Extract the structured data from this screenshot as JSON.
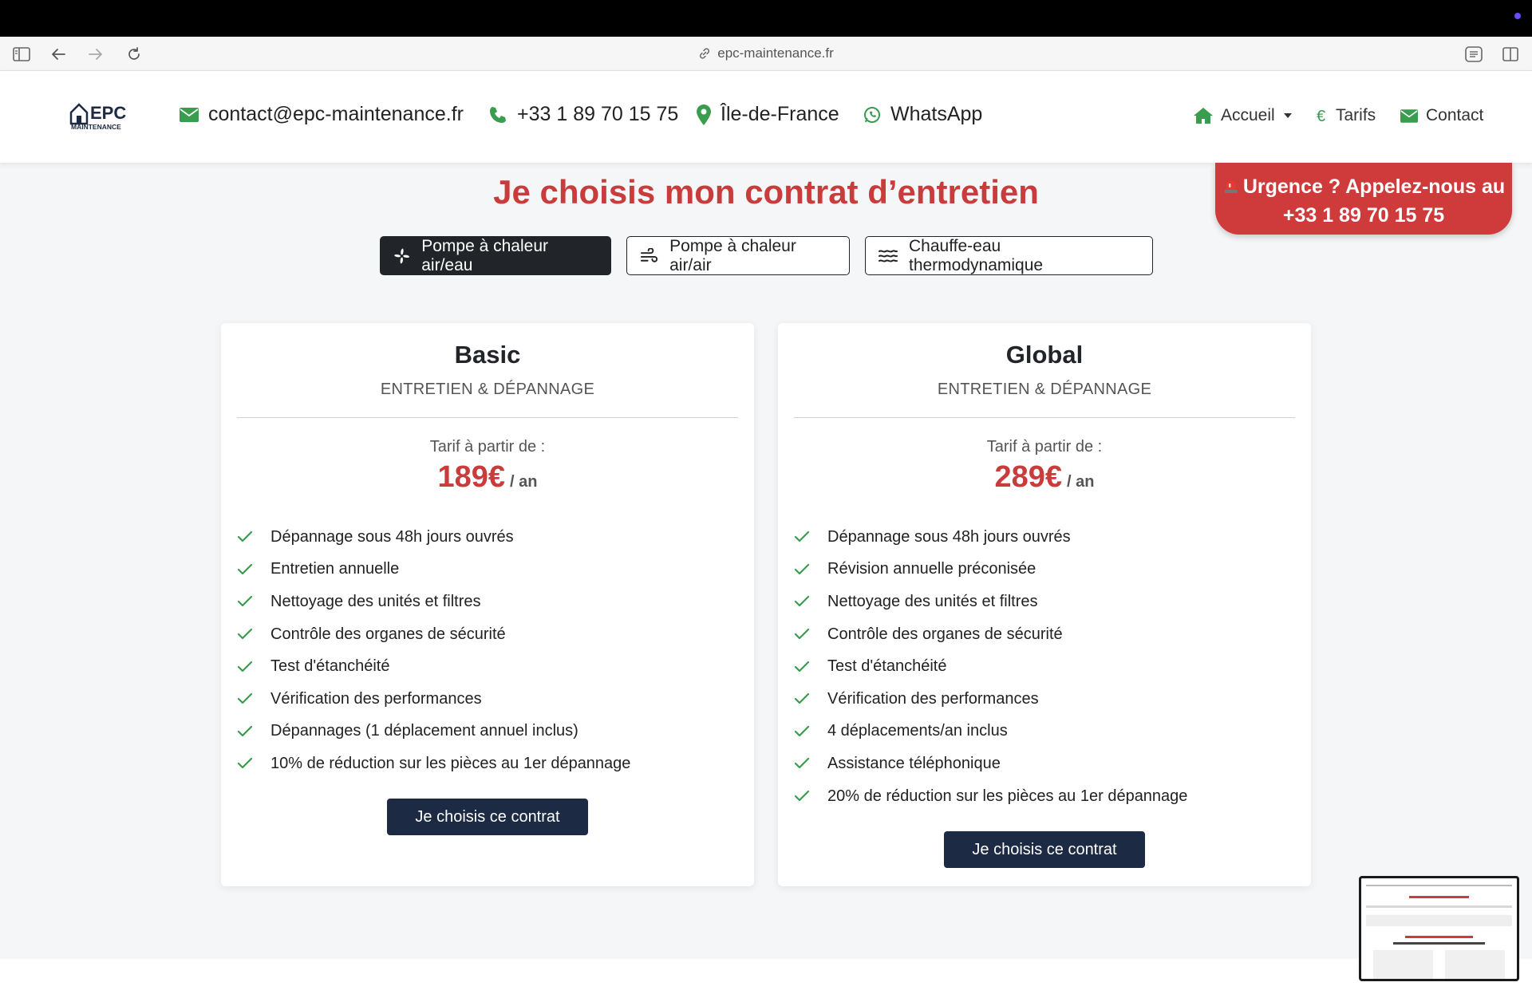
{
  "browser": {
    "url": "epc-maintenance.fr"
  },
  "header": {
    "logo_text": "EPC",
    "logo_subtext": "MAINTENANCE",
    "email": "contact@epc-maintenance.fr",
    "phone": "+33 1 89 70 15 75",
    "region": "Île-de-France",
    "whatsapp": "WhatsApp",
    "nav": {
      "home": "Accueil",
      "prices": "Tarifs",
      "contact": "Contact"
    }
  },
  "urgent": {
    "line1": "Urgence ? Appelez-nous au",
    "line2": "+33 1 89 70 15 75"
  },
  "main": {
    "title": "Je choisis mon contrat d’entretien",
    "tabs": [
      {
        "label": "Pompe à chaleur air/eau",
        "active": true
      },
      {
        "label": "Pompe à chaleur air/air",
        "active": false
      },
      {
        "label": "Chauffe-eau thermodynamique",
        "active": false
      }
    ]
  },
  "plans": [
    {
      "name": "Basic",
      "subtitle": "ENTRETIEN & DÉPANNAGE",
      "from_label": "Tarif à partir de :",
      "price": "189€",
      "period": "/ an",
      "features": [
        "Dépannage sous 48h jours ouvrés",
        "Entretien annuelle",
        "Nettoyage des unités et filtres",
        "Contrôle des organes de sécurité",
        "Test d'étanchéité",
        "Vérification des performances",
        "Dépannages (1 déplacement annuel inclus)",
        "10% de réduction sur les pièces au 1er dépannage"
      ],
      "cta": "Je choisis ce contrat"
    },
    {
      "name": "Global",
      "subtitle": "ENTRETIEN & DÉPANNAGE",
      "from_label": "Tarif à partir de :",
      "price": "289€",
      "period": "/ an",
      "features": [
        "Dépannage sous 48h jours ouvrés",
        "Révision annuelle préconisée",
        "Nettoyage des unités et filtres",
        "Contrôle des organes de sécurité",
        "Test d'étanchéité",
        "Vérification des performances",
        "4 déplacements/an inclus",
        "Assistance téléphonique",
        "20% de réduction sur les pièces au 1er dépannage"
      ],
      "cta": "Je choisis ce contrat"
    }
  ],
  "colors": {
    "accent_red": "#c93c3c",
    "brand_navy": "#1c2a44",
    "icon_green": "#3a9c4e"
  }
}
